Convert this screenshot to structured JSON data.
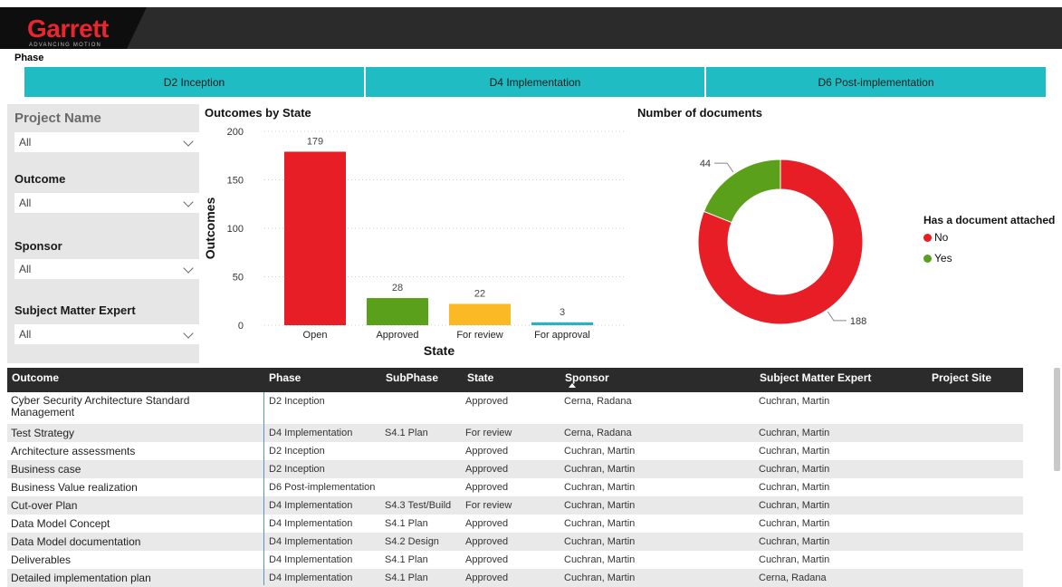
{
  "brand": {
    "name": "Garrett",
    "tagline": "ADVANCING MOTION",
    "color": "#e8262c"
  },
  "phase": {
    "label": "Phase",
    "buttons": [
      "D2 Inception",
      "D4 Implementation",
      "D6 Post-implementation"
    ],
    "color": "#1fbcc3"
  },
  "slicers": [
    {
      "title": "Project Name",
      "value": "All"
    },
    {
      "title": "Outcome",
      "value": "All"
    },
    {
      "title": "Sponsor",
      "value": "All"
    },
    {
      "title": "Subject Matter Expert",
      "value": "All"
    }
  ],
  "chart_data": [
    {
      "type": "bar",
      "title": "Outcomes by State",
      "xlabel": "State",
      "ylabel": "Outcomes",
      "categories": [
        "Open",
        "Approved",
        "For review",
        "For approval"
      ],
      "values": [
        179,
        28,
        22,
        3
      ],
      "data_labels": [
        "179",
        "28",
        "22",
        "3"
      ],
      "yticks": [
        "0",
        "50",
        "100",
        "150",
        "200"
      ],
      "ylim": [
        0,
        200
      ],
      "grid": true,
      "colors": [
        "#e81e26",
        "#5ba01a",
        "#fbb925",
        "#27b2c5"
      ]
    },
    {
      "type": "pie",
      "title": "Number of documents",
      "legend_title": "Has a document attached",
      "labels": [
        "No",
        "Yes"
      ],
      "values": [
        188,
        44
      ],
      "data_labels": [
        "188",
        "44"
      ],
      "colors": [
        "#e81e26",
        "#5ba01a"
      ],
      "legend_position": "right"
    }
  ],
  "table": {
    "columns": [
      "Outcome",
      "Phase",
      "SubPhase",
      "State",
      "Sponsor",
      "Subject Matter Expert",
      "Project Site"
    ],
    "rows": [
      [
        "Cyber Security Architecture Standard Management",
        "D2 Inception",
        "",
        "Approved",
        "Cerna, Radana",
        "Cuchran, Martin",
        ""
      ],
      [
        "Test Strategy",
        "D4 Implementation",
        "S4.1 Plan",
        "For review",
        "Cerna, Radana",
        "Cuchran, Martin",
        ""
      ],
      [
        "Architecture assessments",
        "D2 Inception",
        "",
        "Approved",
        "Cuchran, Martin",
        "Cuchran, Martin",
        ""
      ],
      [
        "Business case",
        "D2 Inception",
        "",
        "Approved",
        "Cuchran, Martin",
        "Cuchran, Martin",
        ""
      ],
      [
        "Business Value realization",
        "D6 Post-implementation",
        "",
        "Approved",
        "Cuchran, Martin",
        "Cuchran, Martin",
        ""
      ],
      [
        "Cut-over Plan",
        "D4 Implementation",
        "S4.3 Test/Build",
        "For review",
        "Cuchran, Martin",
        "Cuchran, Martin",
        ""
      ],
      [
        "Data Model Concept",
        "D4 Implementation",
        "S4.1 Plan",
        "Approved",
        "Cuchran, Martin",
        "Cuchran, Martin",
        ""
      ],
      [
        "Data Model documentation",
        "D4 Implementation",
        "S4.2 Design",
        "Approved",
        "Cuchran, Martin",
        "Cuchran, Martin",
        ""
      ],
      [
        "Deliverables",
        "D4 Implementation",
        "S4.1 Plan",
        "Approved",
        "Cuchran, Martin",
        "Cuchran, Martin",
        ""
      ],
      [
        "Detailed implementation plan",
        "D4 Implementation",
        "S4.1 Plan",
        "Approved",
        "Cuchran, Martin",
        "Cerna, Radana",
        ""
      ]
    ]
  }
}
